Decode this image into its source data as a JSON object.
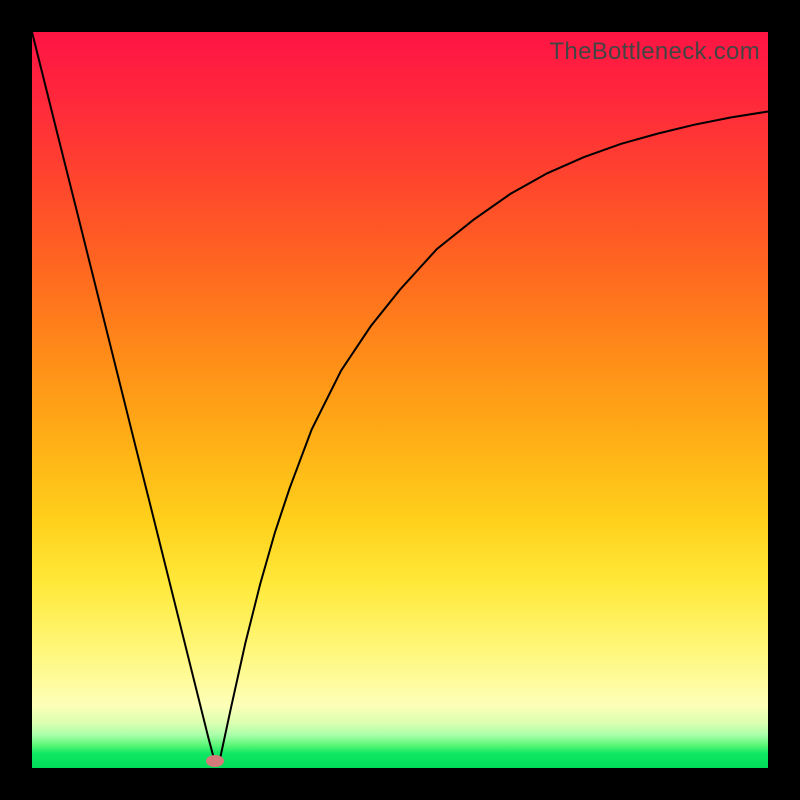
{
  "attribution": "TheBottleneck.com",
  "chart_data": {
    "type": "line",
    "title": "",
    "xlabel": "",
    "ylabel": "",
    "xlim": [
      0,
      100
    ],
    "ylim": [
      0,
      100
    ],
    "grid": false,
    "legend": false,
    "bg_gradient_stops": [
      {
        "pct": 0,
        "color": "#ff1444"
      },
      {
        "pct": 10,
        "color": "#ff2a3a"
      },
      {
        "pct": 22,
        "color": "#ff4a2b"
      },
      {
        "pct": 33,
        "color": "#ff6a1f"
      },
      {
        "pct": 44,
        "color": "#ff8c18"
      },
      {
        "pct": 55,
        "color": "#ffad16"
      },
      {
        "pct": 66,
        "color": "#ffcf1a"
      },
      {
        "pct": 75,
        "color": "#ffe93a"
      },
      {
        "pct": 84,
        "color": "#fff77a"
      },
      {
        "pct": 91.5,
        "color": "#fdffb8"
      },
      {
        "pct": 94.0,
        "color": "#d9ffb0"
      },
      {
        "pct": 95.5,
        "color": "#aaffaa"
      },
      {
        "pct": 97.0,
        "color": "#55f574"
      },
      {
        "pct": 98.0,
        "color": "#10e864"
      },
      {
        "pct": 100,
        "color": "#00dc5a"
      }
    ],
    "series": [
      {
        "name": "bottleneck-curve",
        "color": "#000000",
        "stroke_width": 2,
        "x": [
          0,
          2,
          4,
          6,
          8,
          10,
          12,
          14,
          16,
          18,
          20,
          22,
          24,
          24.8,
          25.6,
          27,
          29,
          31,
          33,
          35,
          38,
          42,
          46,
          50,
          55,
          60,
          65,
          70,
          75,
          80,
          85,
          90,
          95,
          100
        ],
        "y": [
          100,
          92,
          84,
          76,
          68,
          60,
          52,
          44,
          36,
          28,
          20,
          12,
          4,
          1.0,
          1.5,
          8,
          17,
          25,
          32,
          38,
          46,
          54,
          60,
          65,
          70.5,
          74.5,
          78,
          80.8,
          83.0,
          84.8,
          86.2,
          87.4,
          88.4,
          89.2
        ]
      }
    ],
    "marker": {
      "x": 24.8,
      "y": 1.0,
      "color": "#d47a7a"
    }
  }
}
